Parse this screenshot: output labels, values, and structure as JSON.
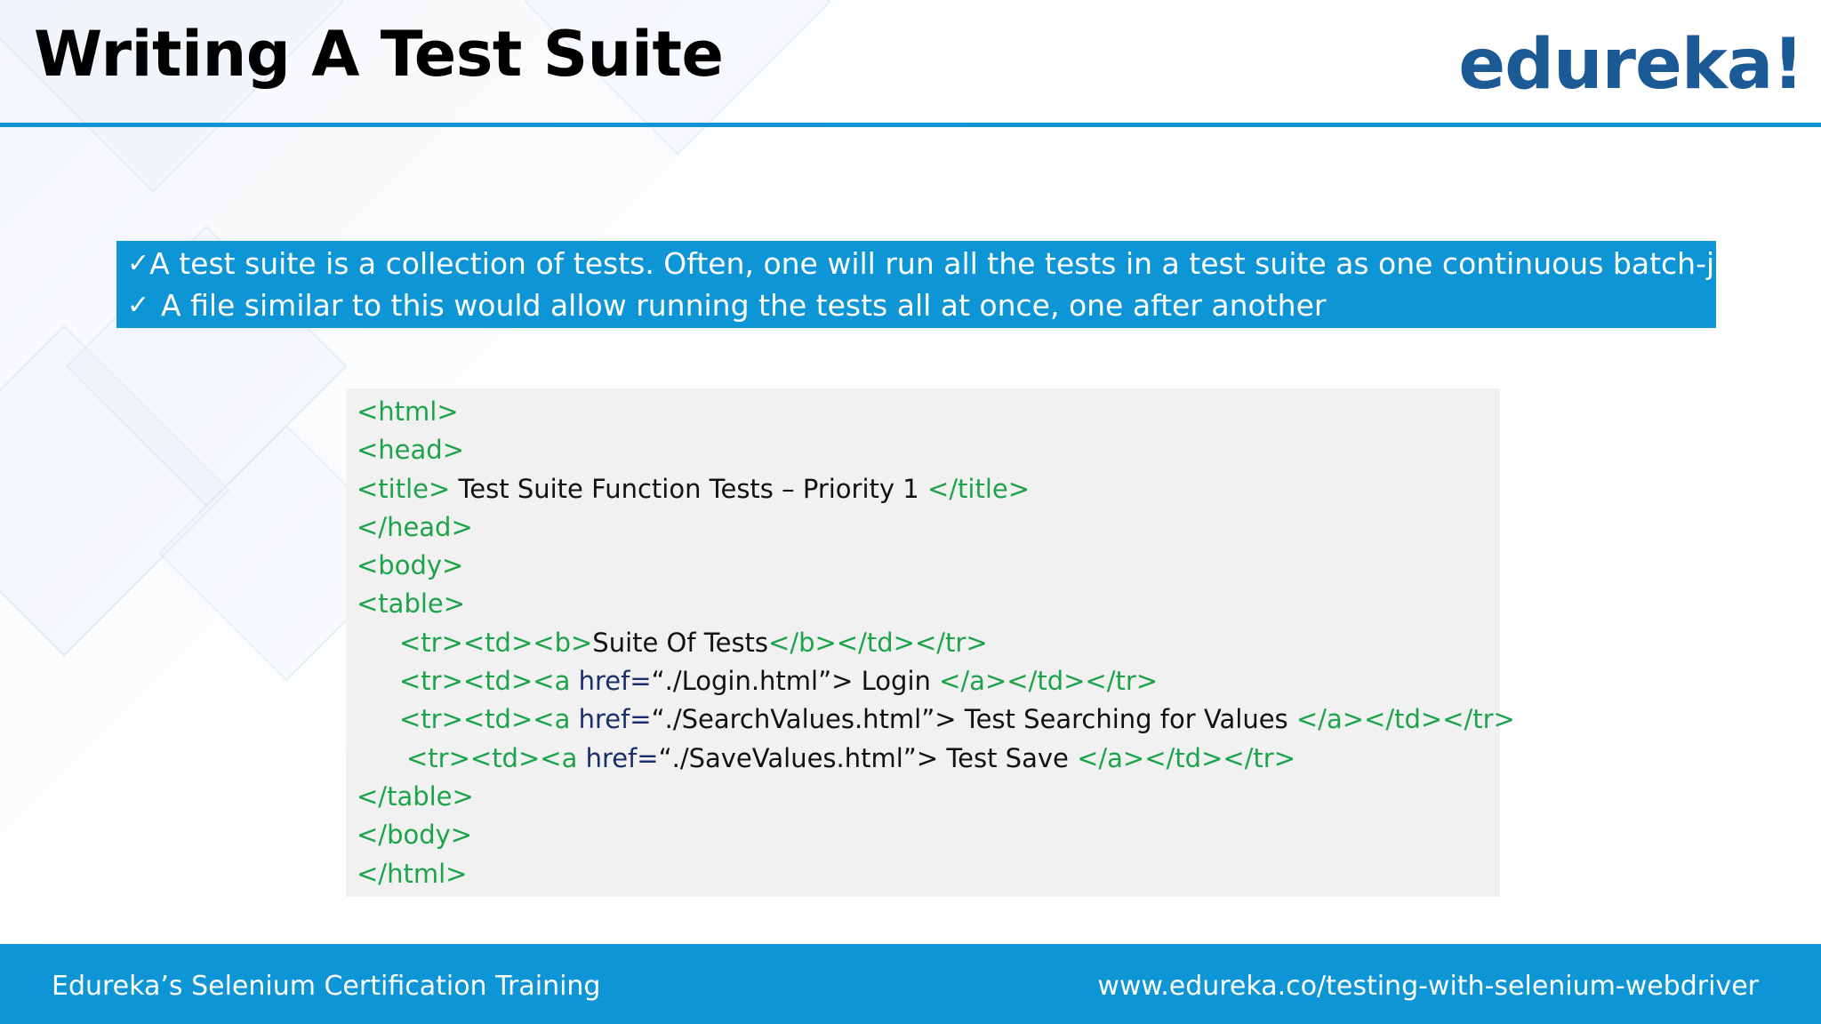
{
  "slide": {
    "title": "Writing A Test Suite",
    "logo": "edureka!",
    "bullets": [
      "A test suite is a collection of tests. Often, one will run all the tests in a test suite as one continuous batch-job",
      "A file similar to this would allow running the tests all at once, one after another"
    ],
    "check_glyph": "✓"
  },
  "code": {
    "l1": "<html>",
    "l2": "<head>",
    "l3_open": "<title>",
    "l3_text": " Test Suite Function Tests – Priority 1 ",
    "l3_close": "</title>",
    "l4": "</head>",
    "l5": "<body>",
    "l6": "<table>",
    "l7_open": "<tr><td><b>",
    "l7_text": "Suite Of Tests",
    "l7_close": "</b></td></tr>",
    "l8_open": "<tr><td><a ",
    "l8_attr": "href=",
    "l8_text": "“./Login.html”> Login ",
    "l8_close": "</a></td></tr>",
    "l9_open": "<tr><td><a ",
    "l9_attr": "href=",
    "l9_text": "“./SearchValues.html”> Test Searching for Values ",
    "l9_close": "</a></td></tr>",
    "l10_open": "<tr><td><a ",
    "l10_attr": "href=",
    "l10_text": "“./SaveValues.html”> Test Save ",
    "l10_close": "</a></td></tr>",
    "l11": "</table>",
    "l12": "</body>",
    "l13": "</html>"
  },
  "footer": {
    "left": "Edureka’s Selenium Certification Training",
    "right": "www.edureka.co/testing-with-selenium-webdriver"
  },
  "colors": {
    "accent_blue": "#0e95d5",
    "logo_blue": "#1c5a96",
    "code_tag_green": "#1da34a",
    "code_attr_navy": "#1b2d6b",
    "code_background": "#f1f1f1"
  }
}
